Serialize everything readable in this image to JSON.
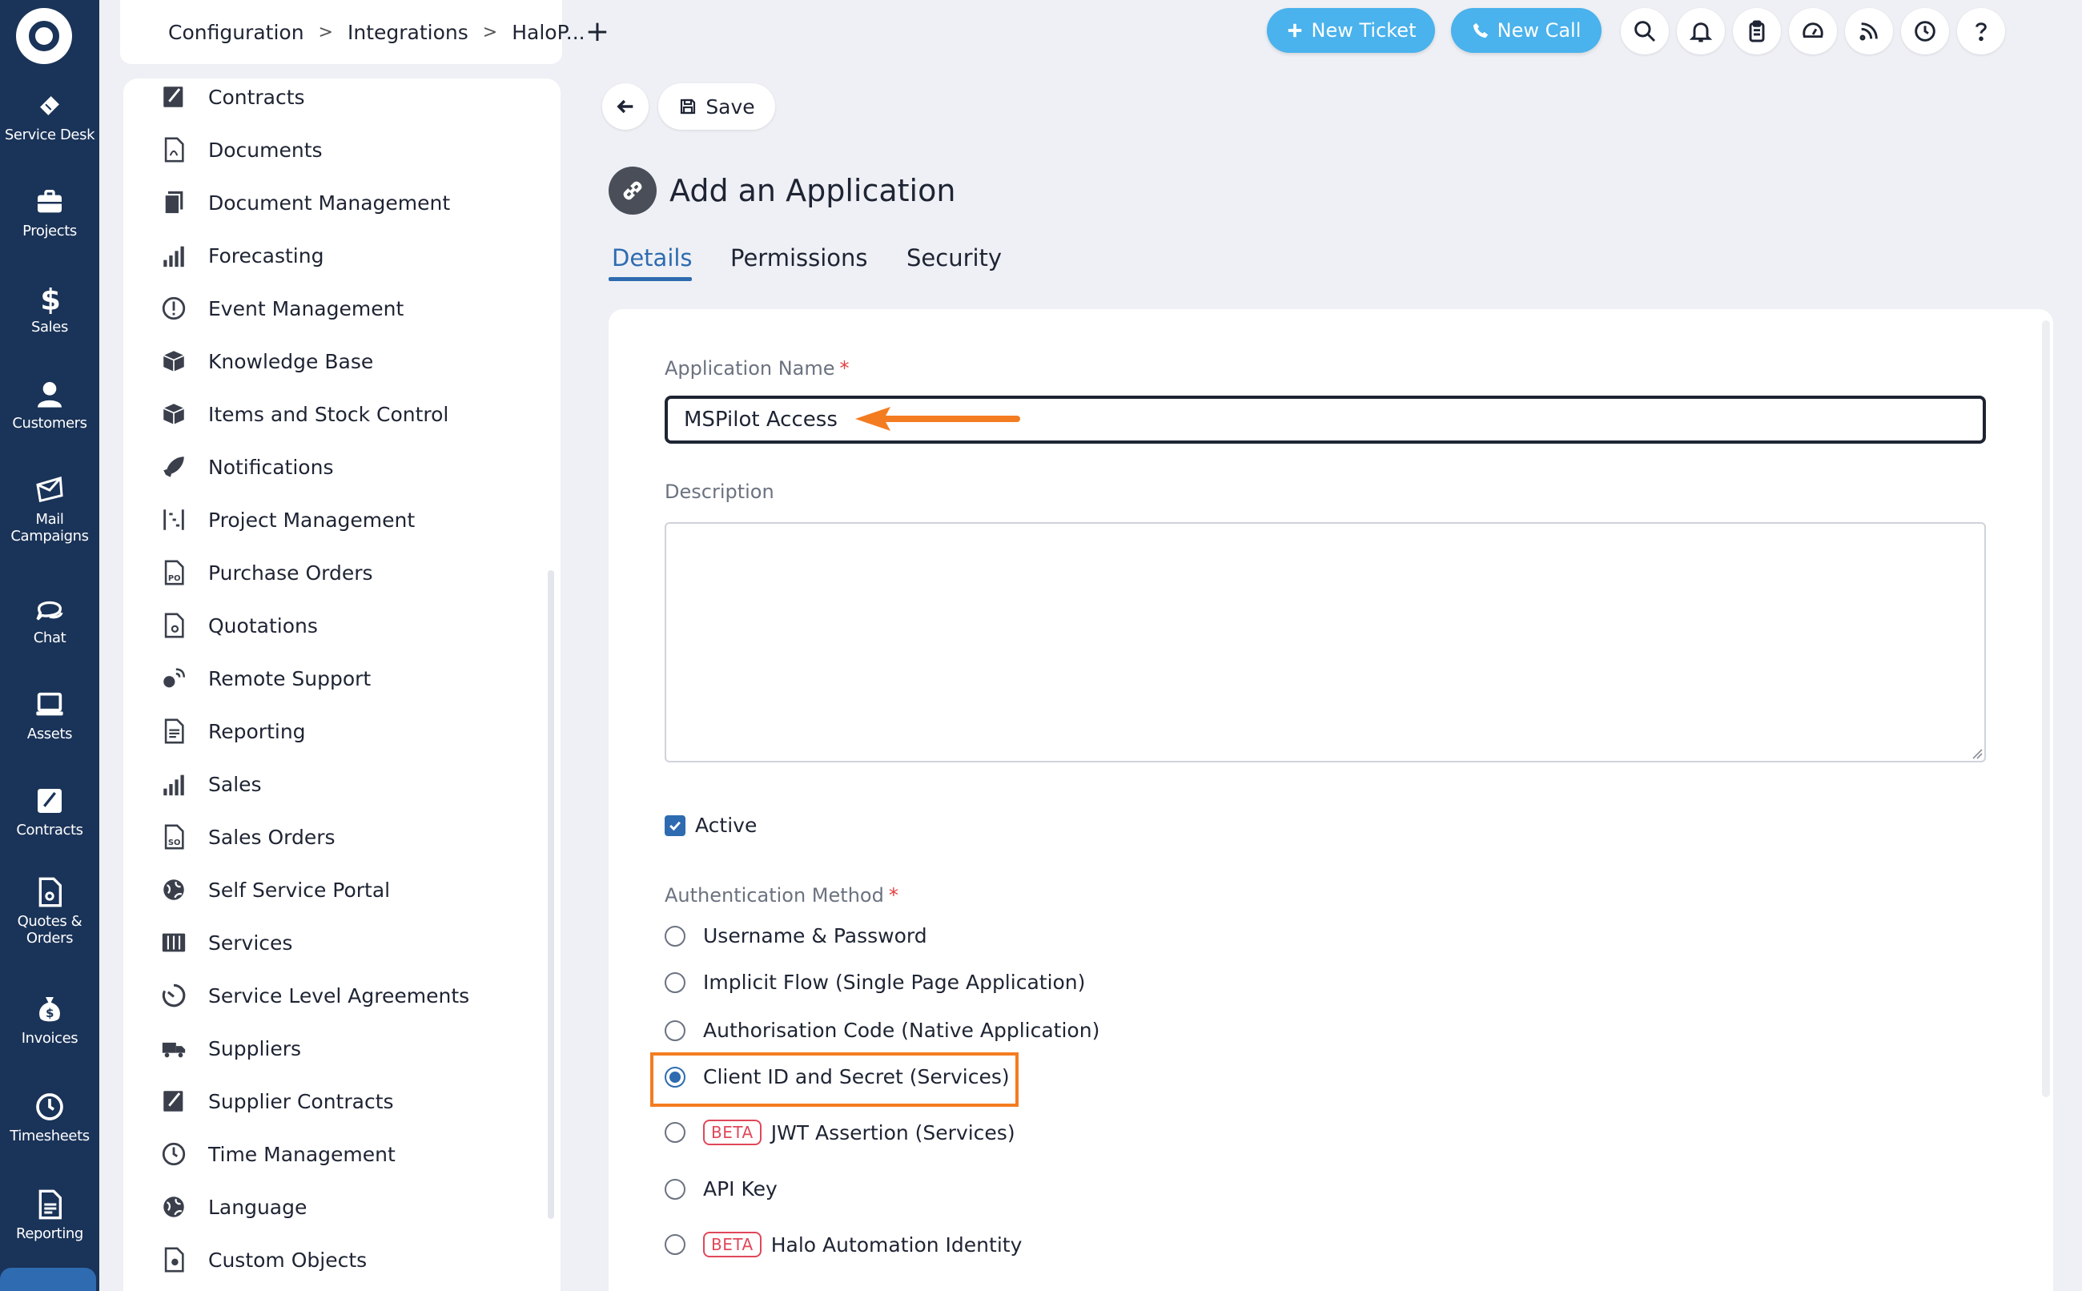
{
  "rail": {
    "items": [
      {
        "label": "Service Desk",
        "icon": "ticket-icon"
      },
      {
        "label": "Projects",
        "icon": "briefcase-icon"
      },
      {
        "label": "Sales",
        "icon": "dollar-icon"
      },
      {
        "label": "Customers",
        "icon": "user-icon"
      },
      {
        "label": "Mail Campaigns",
        "icon": "mail-icon"
      },
      {
        "label": "Chat",
        "icon": "chat-icon"
      },
      {
        "label": "Assets",
        "icon": "laptop-icon"
      },
      {
        "label": "Contracts",
        "icon": "contract-icon"
      },
      {
        "label": "Quotes & Orders",
        "icon": "quote-icon"
      },
      {
        "label": "Invoices",
        "icon": "money-bag-icon"
      },
      {
        "label": "Timesheets",
        "icon": "clock-icon"
      },
      {
        "label": "Reporting",
        "icon": "report-icon"
      }
    ]
  },
  "breadcrumb": {
    "items": [
      "Configuration",
      "Integrations",
      "HaloP..."
    ],
    "separator": ">"
  },
  "topbar": {
    "new_tab": "+",
    "new_ticket": "New Ticket",
    "new_call": "New Call",
    "accent": "#4ab2ec"
  },
  "config_list": {
    "items": [
      "Contracts",
      "Documents",
      "Document Management",
      "Forecasting",
      "Event Management",
      "Knowledge Base",
      "Items and Stock Control",
      "Notifications",
      "Project Management",
      "Purchase Orders",
      "Quotations",
      "Remote Support",
      "Reporting",
      "Sales",
      "Sales Orders",
      "Self Service Portal",
      "Services",
      "Service Level Agreements",
      "Suppliers",
      "Supplier Contracts",
      "Time Management",
      "Language",
      "Custom Objects"
    ]
  },
  "toolbar": {
    "save_label": "Save"
  },
  "page": {
    "title": "Add an Application"
  },
  "tabs": [
    {
      "label": "Details",
      "active": true
    },
    {
      "label": "Permissions",
      "active": false
    },
    {
      "label": "Security",
      "active": false
    }
  ],
  "form": {
    "app_name_label": "Application Name",
    "app_name_value": "MSPilot Access",
    "required_mark": "*",
    "description_label": "Description",
    "description_value": "",
    "active_label": "Active",
    "active_checked": true,
    "auth_label": "Authentication Method",
    "auth_options": [
      {
        "label": "Username & Password",
        "selected": false,
        "beta": false
      },
      {
        "label": "Implicit Flow (Single Page Application)",
        "selected": false,
        "beta": false
      },
      {
        "label": "Authorisation Code (Native Application)",
        "selected": false,
        "beta": false
      },
      {
        "label": "Client ID and Secret (Services)",
        "selected": true,
        "beta": false
      },
      {
        "label": "JWT Assertion (Services)",
        "selected": false,
        "beta": true
      },
      {
        "label": "API Key",
        "selected": false,
        "beta": false
      },
      {
        "label": "Halo Automation Identity",
        "selected": false,
        "beta": true
      }
    ],
    "beta_label": "BETA"
  },
  "colors": {
    "rail": "#1a3358",
    "primary": "#2e6bb0",
    "annotation": "#f47c20",
    "beta": "#e0475a"
  }
}
